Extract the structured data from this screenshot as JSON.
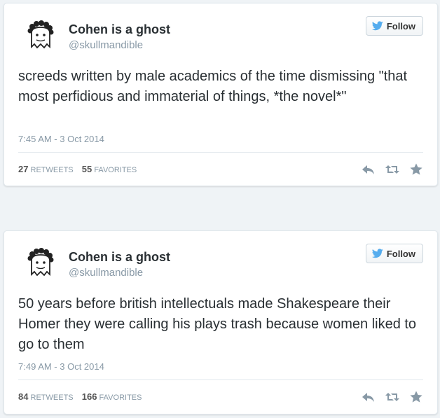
{
  "colors": {
    "background": "#eff3f6",
    "card": "#ffffff",
    "border": "#e1e8ed",
    "text": "#292f33",
    "meta": "#8899a6",
    "twitter_blue": "#55acee",
    "action_icon": "#8899a6"
  },
  "tweets": [
    {
      "author_name": "Cohen is a ghost",
      "handle": "@skullmandible",
      "follow_label": "Follow",
      "text": "screeds written by male academics of the time dismissing \"that most perfidious and immaterial of things, *the novel*\"",
      "timestamp": "7:45 AM - 3 Oct 2014",
      "retweets_count": "27",
      "retweets_label": "RETWEETS",
      "favorites_count": "55",
      "favorites_label": "FAVORITES",
      "icons": [
        "reply-icon",
        "retweet-icon",
        "favorite-icon"
      ]
    },
    {
      "author_name": "Cohen is a ghost",
      "handle": "@skullmandible",
      "follow_label": "Follow",
      "text": "50 years before british intellectuals made Shakespeare their Homer they were calling his plays trash because women liked to go to them",
      "timestamp": "7:49 AM - 3 Oct 2014",
      "retweets_count": "84",
      "retweets_label": "RETWEETS",
      "favorites_count": "166",
      "favorites_label": "FAVORITES",
      "icons": [
        "reply-icon",
        "retweet-icon",
        "favorite-icon"
      ]
    }
  ]
}
